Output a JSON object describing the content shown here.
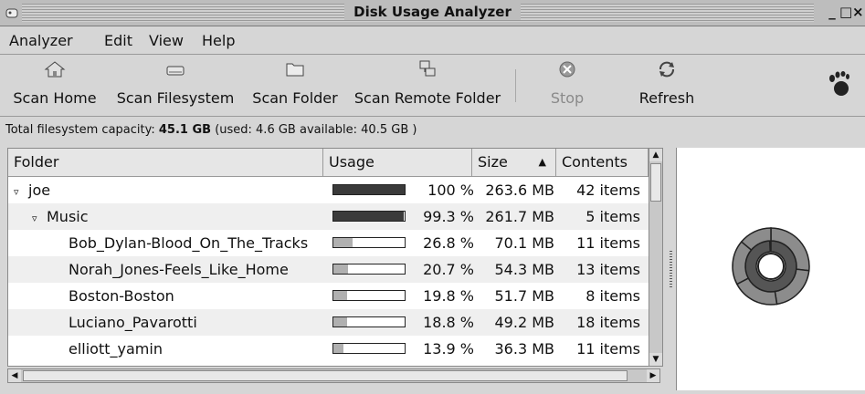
{
  "window": {
    "title": "Disk Usage Analyzer"
  },
  "menubar": {
    "items": [
      "Analyzer",
      "Edit",
      "View",
      "Help"
    ]
  },
  "toolbar": {
    "scan_home": "Scan Home",
    "scan_filesystem": "Scan Filesystem",
    "scan_folder": "Scan Folder",
    "scan_remote": "Scan Remote Folder",
    "stop": "Stop",
    "refresh": "Refresh"
  },
  "capacity": {
    "prefix": "Total filesystem capacity: ",
    "total": "45.1 GB",
    "details": " (used: 4.6 GB available: 40.5 GB )"
  },
  "table": {
    "columns": {
      "folder": "Folder",
      "usage": "Usage",
      "size": "Size",
      "contents": "Contents"
    },
    "rows": [
      {
        "name": "joe",
        "expander": "▿",
        "usage_fraction": 1.0,
        "pct": "100 %",
        "size": "263.6 MB",
        "contents": "42 items"
      },
      {
        "name": "Music",
        "expander": "▿",
        "usage_fraction": 0.993,
        "pct": "99.3 %",
        "size": "261.7 MB",
        "contents": "5 items"
      },
      {
        "name": "Bob_Dylan-Blood_On_The_Tracks",
        "expander": "",
        "usage_fraction": 0.268,
        "pct": "26.8 %",
        "size": "70.1 MB",
        "contents": "11 items"
      },
      {
        "name": "Norah_Jones-Feels_Like_Home",
        "expander": "",
        "usage_fraction": 0.207,
        "pct": "20.7 %",
        "size": "54.3 MB",
        "contents": "13 items"
      },
      {
        "name": "Boston-Boston",
        "expander": "",
        "usage_fraction": 0.198,
        "pct": "19.8 %",
        "size": "51.7 MB",
        "contents": "8 items"
      },
      {
        "name": "Luciano_Pavarotti",
        "expander": "",
        "usage_fraction": 0.188,
        "pct": "18.8 %",
        "size": "49.2 MB",
        "contents": "18 items"
      },
      {
        "name": "elliott_yamin",
        "expander": "",
        "usage_fraction": 0.139,
        "pct": "13.9 %",
        "size": "36.3 MB",
        "contents": "11 items"
      }
    ]
  },
  "colors": {
    "bar_dark": "#3a3a3a",
    "bar_light": "#b0b0b0",
    "ring_dark": "#555555",
    "ring_light": "#8c8c8c"
  }
}
